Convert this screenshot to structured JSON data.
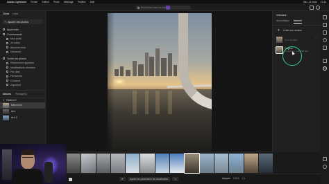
{
  "menubar": {
    "app_name": "Adobe Lightroom",
    "items": [
      "Fichier",
      "Edition",
      "Photo",
      "Affichage",
      "Fenêtre",
      "Aide"
    ],
    "right": [
      "Mer. 13 mars",
      "11:44"
    ]
  },
  "appbar": {
    "search_placeholder": "Rechercher dans les photos"
  },
  "left": {
    "tabs": [
      "Cloud",
      "Local"
    ],
    "add_photos": "Ajouter des photos",
    "nav": [
      {
        "label": "Apprendre",
        "sub": false
      },
      {
        "label": "Communauté",
        "sub": false
      },
      {
        "label": "Mon profil",
        "sub": true
      },
      {
        "label": "Je suivis",
        "sub": true
      },
      {
        "label": "Abonnements",
        "sub": true
      },
      {
        "label": "Découvrir",
        "sub": true
      },
      {
        "label": "Toutes les photos",
        "sub": false
      },
      {
        "label": "Récemment ajoutées",
        "sub": true
      },
      {
        "label": "Modifications récentes",
        "sub": true
      },
      {
        "label": "Par date",
        "sub": true
      },
      {
        "label": "Personnes",
        "sub": true
      },
      {
        "label": "Consenti",
        "sub": true
      },
      {
        "label": "Supprimé",
        "sub": true
      }
    ],
    "album_tabs": [
      "Albums",
      "Partagé(s)"
    ],
    "albums_header": "FAMILLE",
    "albums": [
      "Batiments",
      "Arrt",
      "Arrt 2"
    ]
  },
  "right": {
    "title": "Versions",
    "tabs": [
      "Automatique",
      "Nommé"
    ],
    "create_label": "Créer une version",
    "version_dim": "Non modifiée",
    "version_name": "Original",
    "version_meta": "Il y a 1 min · 1 à 1:36 min"
  },
  "bottombar": {
    "center": [
      "Ajouter les paramètres de classification"
    ],
    "fit_label": "Adapter",
    "zoom": "100%",
    "ratio": "1:1"
  }
}
